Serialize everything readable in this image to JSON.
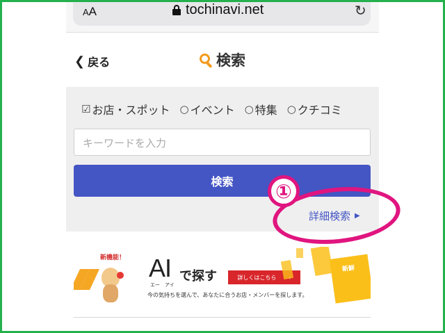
{
  "browser": {
    "text_size_label": "AA",
    "url": "tochinavi.net"
  },
  "nav": {
    "back_label": "戻る",
    "title": "検索"
  },
  "search": {
    "categories": [
      {
        "label": "お店・スポット",
        "checked": true
      },
      {
        "label": "イベント",
        "checked": false
      },
      {
        "label": "特集",
        "checked": false
      },
      {
        "label": "クチコミ",
        "checked": false
      }
    ],
    "keyword_placeholder": "キーワードを入力",
    "submit_label": "検索",
    "advanced_label": "詳細検索"
  },
  "banner": {
    "badge": "新機能！",
    "headline": "AI",
    "ruby": "エー　アイ",
    "headline_suffix": "で探す",
    "button_label": "詳しくはこちら",
    "description": "今の気持ちを選んで、あなたに合うお店・メンバーを探します。",
    "card_label": "新鮮"
  },
  "annotation": {
    "number": "①"
  },
  "colors": {
    "accent_blue": "#4455c4",
    "accent_orange": "#f39a1d",
    "annotation_pink": "#e0157f",
    "frame_green": "#22b14c"
  }
}
